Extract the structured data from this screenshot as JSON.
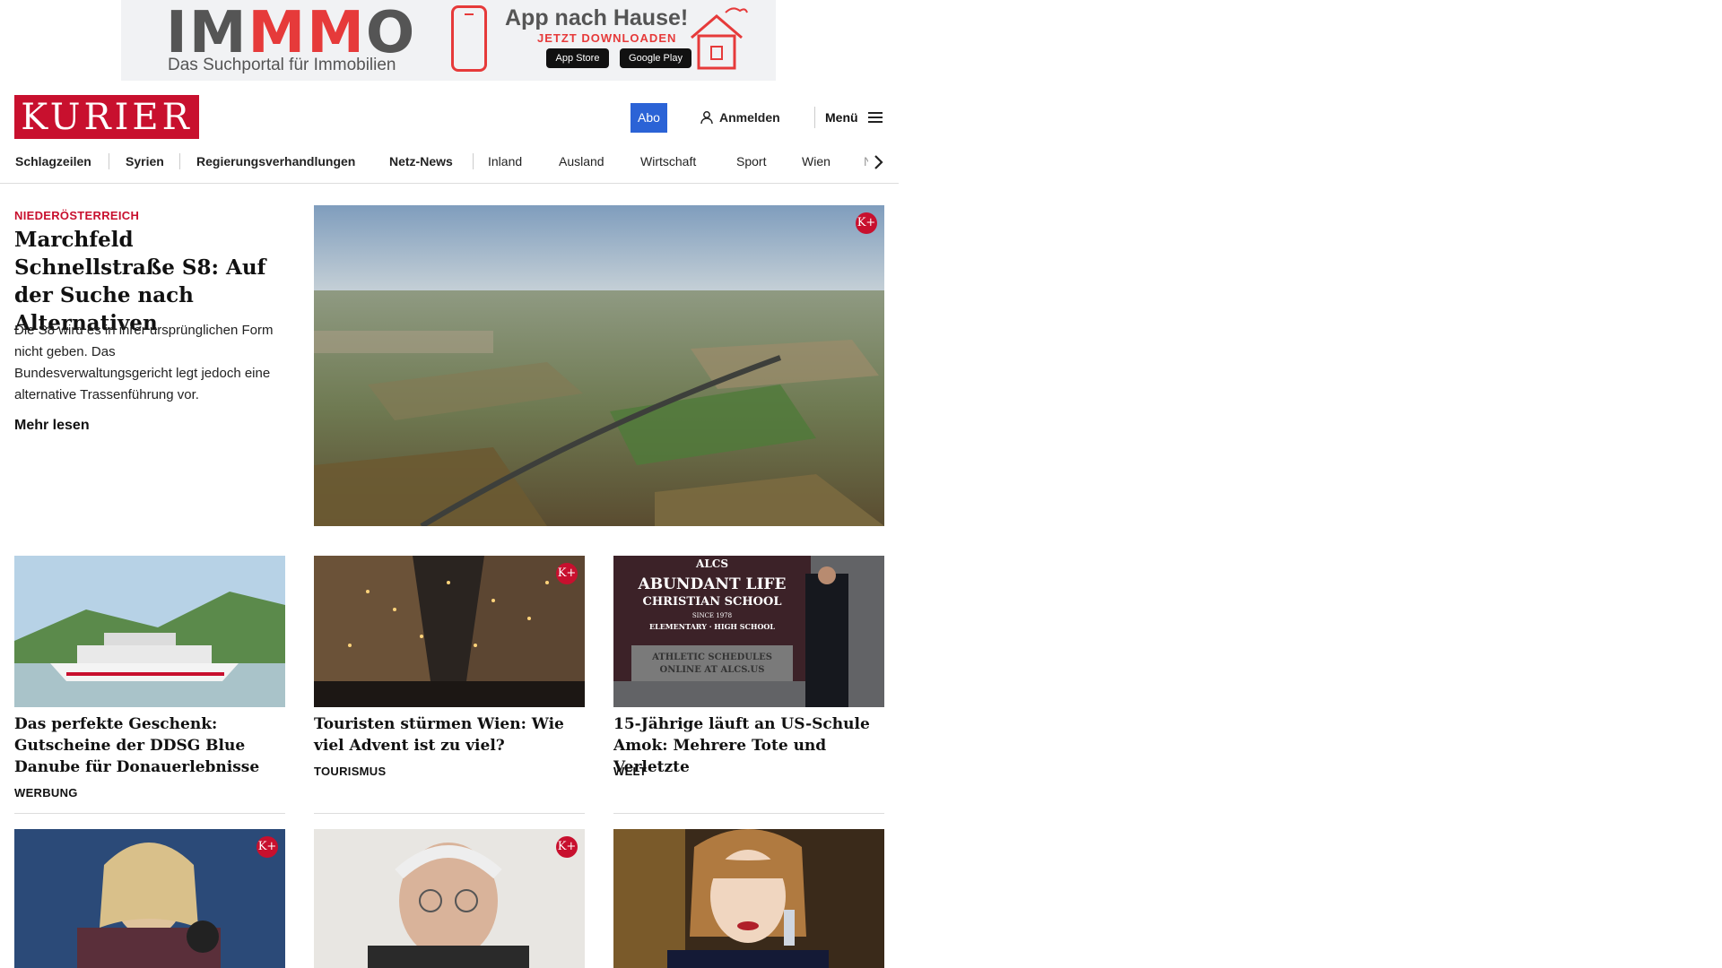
{
  "ad": {
    "brand_a": "IM",
    "brand_mm": "MM",
    "brand_b": "O",
    "tagline": "Das Suchportal für Immobilien",
    "headline": "App nach Hause!",
    "subline": "JETZT DOWNLOADEN",
    "app_store": "App Store",
    "google_play": "Google Play",
    "accent_color": "#e63a3a"
  },
  "header": {
    "logo": "KURIER",
    "abo": "Abo",
    "login": "Anmelden",
    "menu": "Menü",
    "brand_color": "#c8102e"
  },
  "nav": {
    "items": [
      "Schlagzeilen",
      "Syrien",
      "Regierungsverhandlungen",
      "Netz-News",
      "Inland",
      "Ausland",
      "Wirtschaft",
      "Sport",
      "Wien",
      "Nö"
    ]
  },
  "lead": {
    "category": "NIEDERÖSTERREICH",
    "title": "Marchfeld Schnellstraße S8: Auf der Suche nach Alternativen",
    "teaser": "Die S8 wird es in ihrer ursprünglichen Form nicht geben. Das Bundesverwaltungsgericht legt jedoch eine alternative Trassenführung vor.",
    "more": "Mehr lesen",
    "badge": "K+"
  },
  "cards": [
    {
      "title": "Das perfekte Geschenk: Gutscheine der DDSG Blue Danube für Donauerlebnisse",
      "category": "WERBUNG"
    },
    {
      "title": "Touristen stürmen Wien: Wie viel Advent ist zu viel?",
      "category": "TOURISMUS",
      "badge": "K+"
    },
    {
      "title": "15-Jährige läuft an US-Schule Amok: Mehrere Tote und Verletzte",
      "category": "WELT",
      "sign": [
        "ALCS",
        "ABUNDANT LIFE",
        "CHRISTIAN SCHOOL",
        "SINCE 1978",
        "ELEMENTARY · HIGH SCHOOL",
        "ATHLETIC SCHEDULES",
        "ONLINE AT ALCS.US"
      ]
    }
  ],
  "row2": [
    {
      "badge": "K+"
    },
    {
      "badge": "K+"
    },
    {}
  ]
}
